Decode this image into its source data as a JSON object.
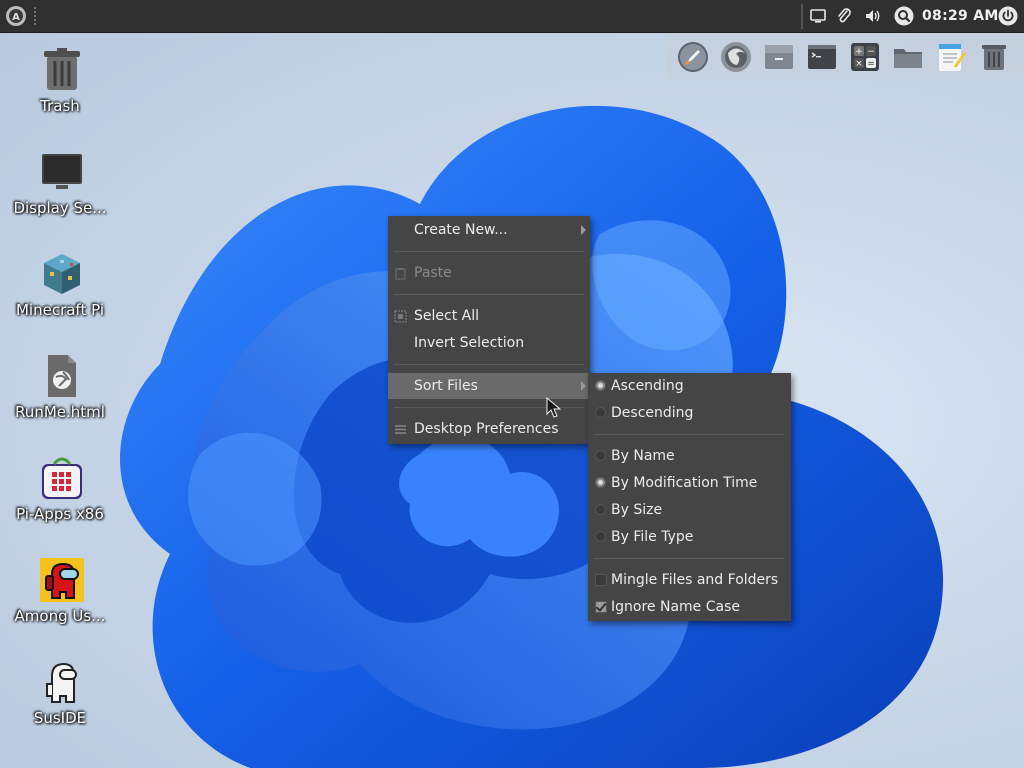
{
  "panel": {
    "clock": "08:29 AM"
  },
  "desktop_icons": [
    {
      "label": "Trash",
      "icon": "trash-icon"
    },
    {
      "label": "Display Se...",
      "icon": "monitor-icon"
    },
    {
      "label": "Minecraft Pi",
      "icon": "minecraft-block-icon"
    },
    {
      "label": "RunMe.html",
      "icon": "html-file-icon"
    },
    {
      "label": "Pi-Apps x86",
      "icon": "pi-apps-icon"
    },
    {
      "label": "Among Us...",
      "icon": "among-us-icon"
    },
    {
      "label": "SusIDE",
      "icon": "suside-icon"
    }
  ],
  "dock": [
    "rocket-launcher-icon",
    "firefox-icon",
    "file-cabinet-icon",
    "terminal-icon",
    "calculator-icon",
    "folder-icon",
    "text-editor-icon",
    "trash-icon"
  ],
  "context_menu": {
    "create_new": "Create New...",
    "paste": "Paste",
    "select_all": "Select All",
    "invert_selection": "Invert Selection",
    "sort_files": "Sort Files",
    "desktop_preferences": "Desktop Preferences"
  },
  "sort_submenu": {
    "ascending": "Ascending",
    "descending": "Descending",
    "by_name": "By Name",
    "by_modification_time": "By Modification Time",
    "by_size": "By Size",
    "by_file_type": "By File Type",
    "mingle": "Mingle Files and Folders",
    "ignore_case": "Ignore Name Case"
  },
  "colors": {
    "panel": "#303030",
    "menu_bg": "#454545",
    "menu_highlight": "#6a6a6a",
    "wallpaper_blue": "#1e63e6"
  }
}
